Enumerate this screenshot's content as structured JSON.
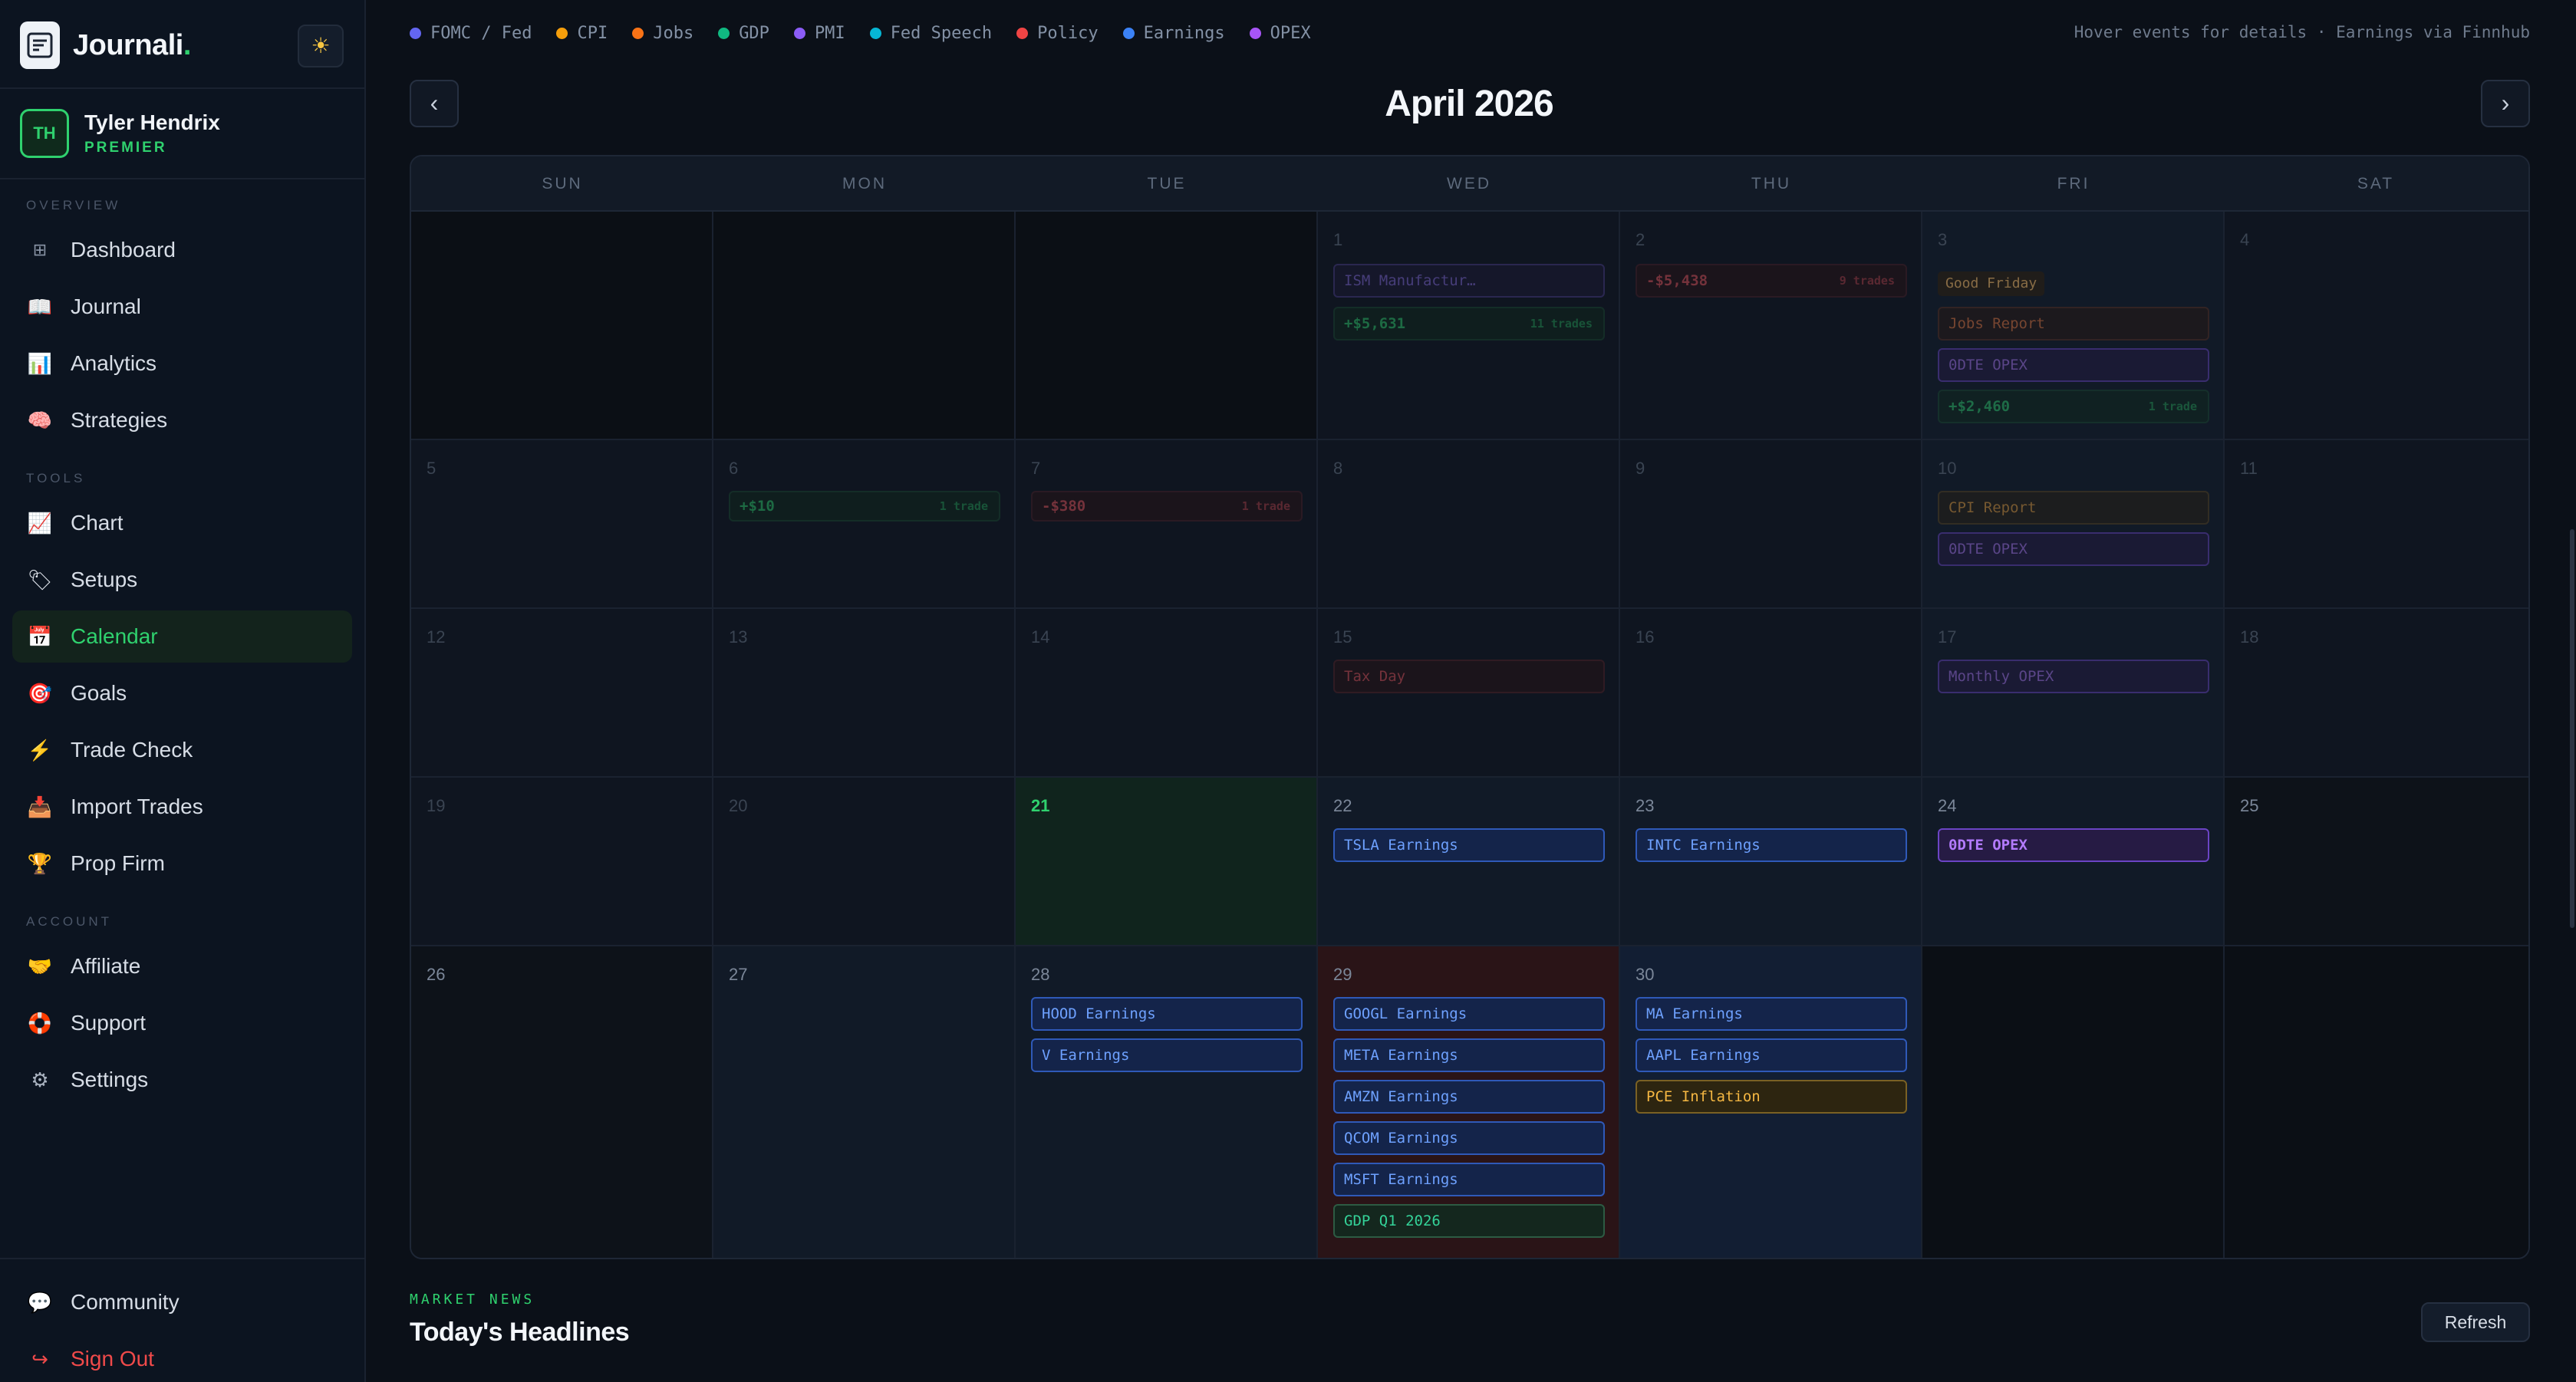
{
  "brand": {
    "name": "Journali",
    "dot": "."
  },
  "user": {
    "initials": "TH",
    "name": "Tyler Hendrix",
    "tier": "PREMIER"
  },
  "sidebar": {
    "sections": {
      "overview": "OVERVIEW",
      "tools": "TOOLS",
      "account": "ACCOUNT"
    },
    "items": [
      {
        "label": "Dashboard",
        "icon": "grid-icon"
      },
      {
        "label": "Journal",
        "icon": "book-icon"
      },
      {
        "label": "Analytics",
        "icon": "bar-chart-icon"
      },
      {
        "label": "Strategies",
        "icon": "brain-icon"
      },
      {
        "label": "Chart",
        "icon": "line-chart-icon"
      },
      {
        "label": "Setups",
        "icon": "tag-icon"
      },
      {
        "label": "Calendar",
        "icon": "calendar-icon",
        "active": true
      },
      {
        "label": "Goals",
        "icon": "target-icon"
      },
      {
        "label": "Trade Check",
        "icon": "bolt-icon"
      },
      {
        "label": "Import Trades",
        "icon": "inbox-icon"
      },
      {
        "label": "Prop Firm",
        "icon": "trophy-icon"
      },
      {
        "label": "Affiliate",
        "icon": "handshake-icon"
      },
      {
        "label": "Support",
        "icon": "lifebuoy-icon"
      },
      {
        "label": "Settings",
        "icon": "gear-icon"
      },
      {
        "label": "Community",
        "icon": "chat-icon"
      },
      {
        "label": "Sign Out",
        "icon": "sign-out-icon"
      }
    ]
  },
  "legend": [
    {
      "label": "FOMC / Fed",
      "color": "#6366f1"
    },
    {
      "label": "CPI",
      "color": "#f59e0b"
    },
    {
      "label": "Jobs",
      "color": "#f97316"
    },
    {
      "label": "GDP",
      "color": "#10b981"
    },
    {
      "label": "PMI",
      "color": "#8b5cf6"
    },
    {
      "label": "Fed Speech",
      "color": "#06b6d4"
    },
    {
      "label": "Policy",
      "color": "#ef4444"
    },
    {
      "label": "Earnings",
      "color": "#3b82f6"
    },
    {
      "label": "OPEX",
      "color": "#a855f7"
    }
  ],
  "hover_note": "Hover events for details · Earnings via Finnhub",
  "calendar": {
    "month_title": "April 2026",
    "prev": "‹",
    "next": "›",
    "weekdays": [
      "SUN",
      "MON",
      "TUE",
      "WED",
      "THU",
      "FRI",
      "SAT"
    ],
    "days": {
      "d1": "1",
      "d2": "2",
      "d3": "3",
      "d4": "4",
      "d5": "5",
      "d6": "6",
      "d7": "7",
      "d8": "8",
      "d9": "9",
      "d10": "10",
      "d11": "11",
      "d12": "12",
      "d13": "13",
      "d14": "14",
      "d15": "15",
      "d16": "16",
      "d17": "17",
      "d18": "18",
      "d19": "19",
      "d20": "20",
      "d21": "21",
      "d22": "22",
      "d23": "23",
      "d24": "24",
      "d25": "25",
      "d26": "26",
      "d27": "27",
      "d28": "28",
      "d29": "29",
      "d30": "30"
    },
    "events": {
      "ism": "ISM Manufactur…",
      "pnl_1": "+$5,631",
      "pnl_1_trades": "11 trades",
      "pnl_2": "-$5,438",
      "pnl_2_trades": "9 trades",
      "good_friday": "Good Friday",
      "jobs_report": "Jobs Report",
      "opex_3": "0DTE OPEX",
      "pnl_3": "+$2,460",
      "pnl_3_trades": "1 trade",
      "pnl_6": "+$10",
      "pnl_6_trades": "1 trade",
      "pnl_7": "-$380",
      "pnl_7_trades": "1 trade",
      "cpi_report": "CPI Report",
      "opex_10": "0DTE OPEX",
      "tax_day": "Tax Day",
      "monthly_opex": "Monthly OPEX",
      "tsla": "TSLA Earnings",
      "intc": "INTC Earnings",
      "opex_24": "0DTE OPEX",
      "hood": "HOOD Earnings",
      "v": "V Earnings",
      "googl": "GOOGL Earnings",
      "meta": "META Earnings",
      "amzn": "AMZN Earnings",
      "qcom": "QCOM Earnings",
      "msft": "MSFT Earnings",
      "gdp": "GDP Q1 2026",
      "ma": "MA Earnings",
      "aapl": "AAPL Earnings",
      "pce": "PCE Inflation"
    }
  },
  "news": {
    "eyebrow": "MARKET NEWS",
    "title": "Today's Headlines",
    "refresh": "Refresh"
  }
}
